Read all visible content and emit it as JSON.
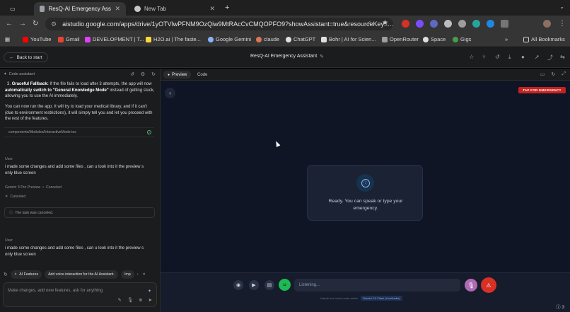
{
  "browser": {
    "tabs": [
      {
        "label": "ResQ-AI Emergency Assistant",
        "active": true
      },
      {
        "label": "New Tab",
        "active": false
      }
    ],
    "url": "aistudio.google.com/apps/drive/1yOTVlwPFNM9OzQiw9MtRAcCvCMQOPFO9?showAssistant=true&resourceKey=...",
    "bookmarks": [
      "YouTube",
      "Gmail",
      "DEVELOPMENT | T...",
      "H2O.ai | The faste...",
      "Google Gemini",
      "claude",
      "ChatGPT",
      "Bohr | AI for Scien...",
      "OpenRouter",
      "Space",
      "Gigs"
    ],
    "all_bookmarks": "All Bookmarks"
  },
  "app": {
    "back_label": "Back to start",
    "title": "ResQ-AI Emergency Assistant"
  },
  "assistant": {
    "header": "Code assistant",
    "fallback_num": "3.",
    "fallback_bold": "Graceful Fallback:",
    "fallback_text1": " If the file fails to load after 3 attempts, the app will now ",
    "fallback_bold2": "automatically switch to \"General Knowledge Mode\"",
    "fallback_text2": " instead of getting stuck, allowing you to use the AI immediately.",
    "run_text": "You can now run the app. It will try to load your medical library, and if it can't (due to environment restrictions), it will simply tell you and let you proceed with the rest of the features.",
    "file_path": "components/Modules/InteractiveMode.tsx",
    "user_label_1": "User",
    "user_msg_1": "i made some changes and add some files , can u look into it the preview s only blue screen",
    "model_label": "Gemini 3 Pro Preview",
    "model_status": "Canceled",
    "canceled_label": "Canceled",
    "task_canceled": "The task was canceled.",
    "user_label_2": "User",
    "user_msg_2": "i made some changes and add some files , can u look into it the preview s only blue screen",
    "chips": [
      "AI Features",
      "Add voice interaction for the AI Assistant.",
      "Imp"
    ],
    "composer_placeholder": "Make changes, add new features, ask for anything"
  },
  "preview": {
    "tab_preview": "Preview",
    "tab_code": "Code",
    "emergency_label": "TAP FOR EMERGENCY",
    "ready_line1": "Ready. You can speak or type your",
    "ready_line2": "emergency.",
    "input_placeholder": "Listening...",
    "hint_text": "Hands-free voice mode active",
    "hint_badge": "Gemini 2.0 Flash (Live/Audio)"
  },
  "status": {
    "count": "3"
  },
  "colors": {
    "emergency_red": "#c5221f",
    "preview_bg": "#0f1524",
    "green": "#1db954",
    "mic_purple": "#b06ab3"
  }
}
